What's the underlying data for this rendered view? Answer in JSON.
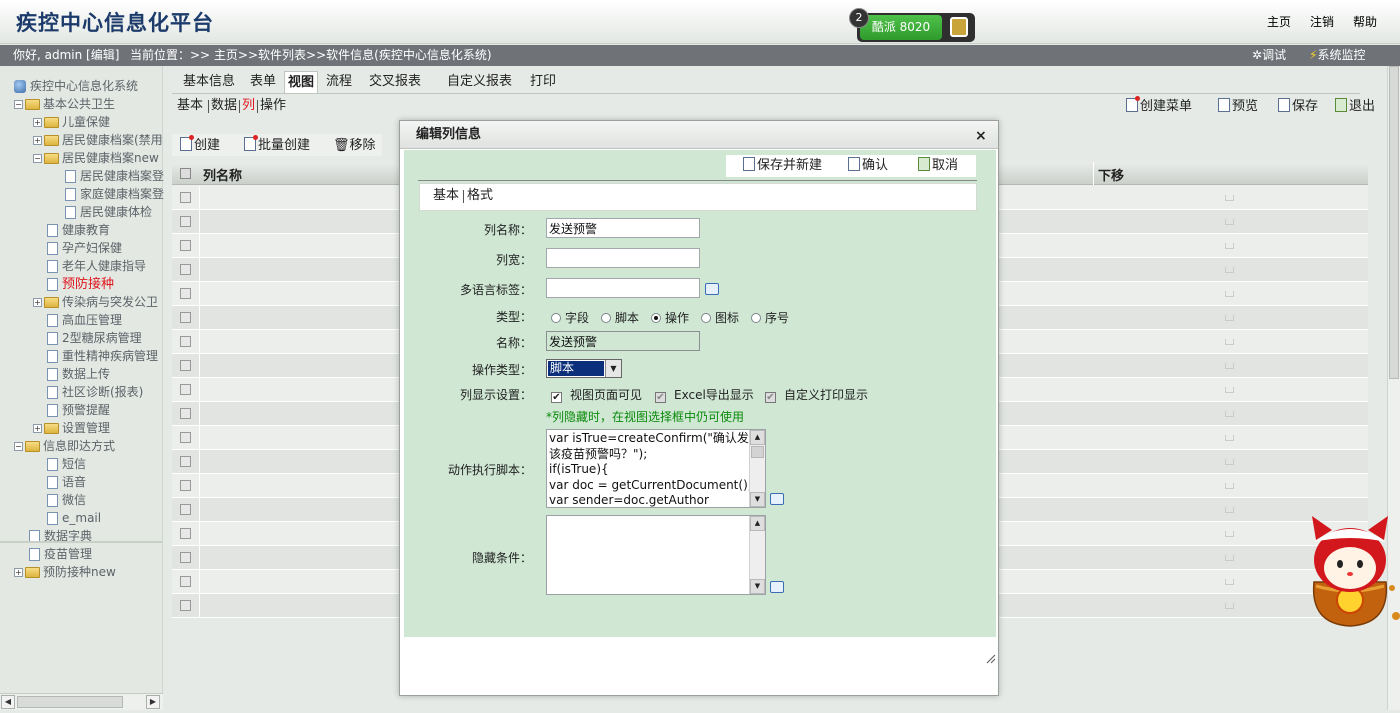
{
  "header": {
    "app_title": "疾控中心信息化平台",
    "status": {
      "badge": "2",
      "label": "酷派  8020"
    },
    "links": {
      "home": "主页",
      "logout": "注销",
      "help": "帮助"
    }
  },
  "subheader": {
    "greeting": "你好, admin [编辑]",
    "location": "当前位置：>> 主页>>软件列表>>软件信息(疾控中心信息化系统)",
    "debug": "调试",
    "monitor": "系统监控"
  },
  "tree": [
    {
      "label": "疾控中心信息化系统",
      "kind": "root"
    },
    {
      "label": "基本公共卫生",
      "kind": "folder",
      "exp": "−"
    },
    {
      "label": "儿童保健",
      "kind": "folder",
      "exp": "+"
    },
    {
      "label": "居民健康档案(禁用",
      "kind": "folder",
      "exp": "+"
    },
    {
      "label": "居民健康档案new",
      "kind": "folder",
      "exp": "−"
    },
    {
      "label": "居民健康档案登",
      "kind": "page"
    },
    {
      "label": "家庭健康档案登",
      "kind": "page"
    },
    {
      "label": "居民健康体检",
      "kind": "page"
    },
    {
      "label": "健康教育",
      "kind": "page"
    },
    {
      "label": "孕产妇保健",
      "kind": "page"
    },
    {
      "label": "老年人健康指导",
      "kind": "page"
    },
    {
      "label": "预防接种",
      "kind": "page",
      "active": true
    },
    {
      "label": "传染病与突发公卫",
      "kind": "folder",
      "exp": "+"
    },
    {
      "label": "高血压管理",
      "kind": "page"
    },
    {
      "label": "2型糖尿病管理",
      "kind": "page"
    },
    {
      "label": "重性精神疾病管理",
      "kind": "page"
    },
    {
      "label": "数据上传",
      "kind": "page"
    },
    {
      "label": "社区诊断(报表)",
      "kind": "page"
    },
    {
      "label": "预警提醒",
      "kind": "page"
    },
    {
      "label": "设置管理",
      "kind": "folder",
      "exp": "+"
    },
    {
      "label": "信息即达方式",
      "kind": "folder",
      "exp": "−"
    },
    {
      "label": "短信",
      "kind": "page"
    },
    {
      "label": "语音",
      "kind": "page"
    },
    {
      "label": "微信",
      "kind": "page"
    },
    {
      "label": "e_mail",
      "kind": "page"
    },
    {
      "label": "数据字典",
      "kind": "page"
    },
    {
      "label": "疫苗管理",
      "kind": "page"
    },
    {
      "label": "预防接种new",
      "kind": "folder",
      "exp": "+"
    }
  ],
  "tabs": [
    "基本信息",
    "表单",
    "视图",
    "流程",
    "交叉报表",
    "自定义报表",
    "打印"
  ],
  "selected_tab": "视图",
  "subnav": [
    "基本",
    "数据",
    "列",
    "操作"
  ],
  "toolbar": {
    "create_menu": "创建菜单",
    "preview": "预览",
    "save": "保存",
    "exit": "退出"
  },
  "list_toolbar": {
    "create": "创建",
    "batch_create": "批量创建",
    "remove": "移除"
  },
  "grid": {
    "col_name": "列名称",
    "col_down": "下移",
    "row_count": 18
  },
  "dialog": {
    "title": "编辑列信息",
    "close": "×",
    "actions": {
      "save_new": "保存并新建",
      "confirm": "确认",
      "cancel": "取消"
    },
    "tabs": [
      "基本",
      "格式"
    ],
    "labels": {
      "col_name": "列名称：",
      "col_width": "列宽：",
      "i18n": "多语言标签：",
      "type": "类型：",
      "name": "名称：",
      "op_type": "操作类型：",
      "display": "列显示设置：",
      "script": "动作执行脚本：",
      "hide": "隐藏条件："
    },
    "values": {
      "col_name": "发送预警",
      "col_width": "",
      "i18n": "",
      "name": "发送预警",
      "op_type": "脚本"
    },
    "type_options": [
      "字段",
      "脚本",
      "操作",
      "图标",
      "序号"
    ],
    "type_selected": "操作",
    "display_options": [
      {
        "label": "视图页面可见",
        "checked": true,
        "disabled": false
      },
      {
        "label": "Excel导出显示",
        "checked": true,
        "disabled": true
      },
      {
        "label": "自定义打印显示",
        "checked": true,
        "disabled": true
      }
    ],
    "hint": "*列隐藏时，在视图选择框中仍可使用",
    "script": "var isTrue=createConfirm(\"确认发送\n该疫苗预警吗？\");\nif(isTrue){\nvar doc = getCurrentDocument();\nvar sender=doc.getAuthor",
    "hide_condition": ""
  }
}
